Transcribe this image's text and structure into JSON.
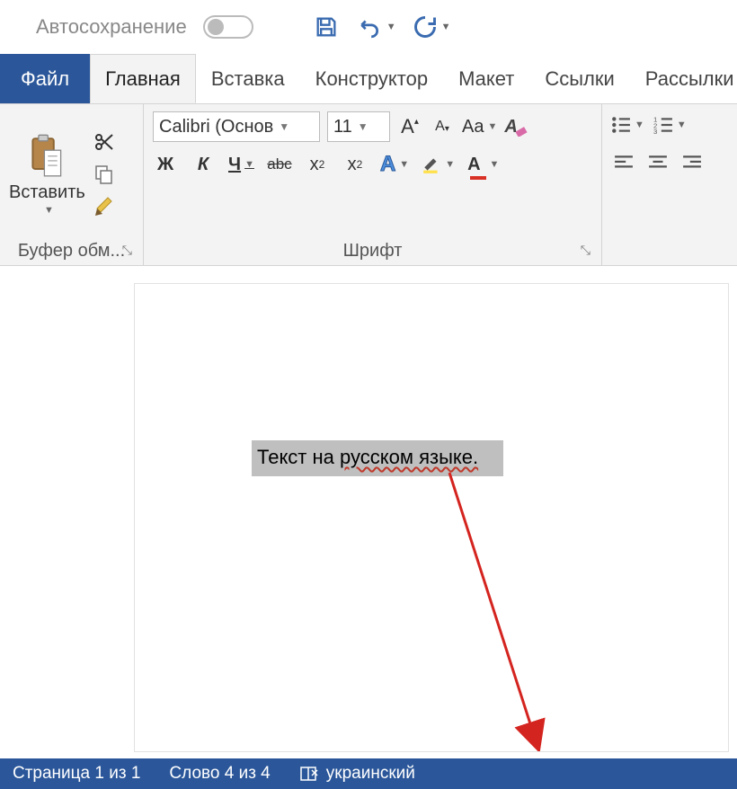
{
  "qat": {
    "autosave": "Автосохранение"
  },
  "tabs": {
    "file": "Файл",
    "home": "Главная",
    "insert": "Вставка",
    "design": "Конструктор",
    "layout": "Макет",
    "references": "Ссылки",
    "mailings": "Рассылки"
  },
  "ribbon": {
    "clipboard": {
      "paste": "Вставить",
      "label": "Буфер обм..."
    },
    "font": {
      "name": "Calibri (Основ",
      "size": "11",
      "bold": "Ж",
      "italic": "К",
      "underline": "Ч",
      "strike": "abc",
      "sub": "x",
      "sup": "x",
      "case": "Aa",
      "bigA": "A",
      "smallA": "A",
      "outlineA": "A",
      "colorA": "A",
      "label": "Шрифт"
    }
  },
  "document": {
    "text_plain": "Текст на ",
    "text_wavy": "русском языке."
  },
  "status": {
    "page": "Страница 1 из 1",
    "words": "Слово 4 из 4",
    "language": "украинский"
  }
}
